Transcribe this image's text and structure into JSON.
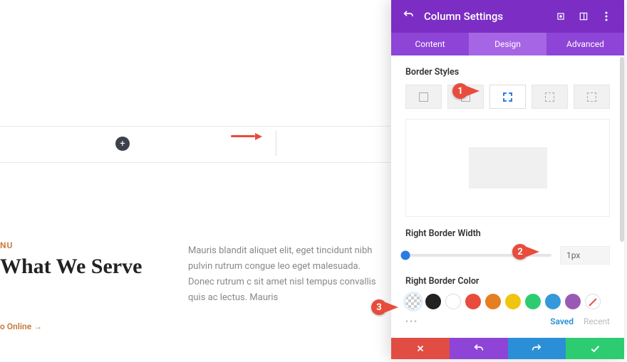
{
  "page": {
    "menu_label": "NU",
    "headline": "What We Serve",
    "paragraph": "Mauris blandit aliquet elit, eget tincidunt nibh pulvin rutrum congue leo eget malesuada. Donec rutrum c sit amet nisl tempus convallis quis ac lectus. Mauris",
    "link_label": "o Online",
    "link_arrow": "→",
    "add_button": "+"
  },
  "panel": {
    "title": "Column Settings",
    "tabs": {
      "content": "Content",
      "design": "Design",
      "advanced": "Advanced"
    },
    "border_styles_label": "Border Styles",
    "right_width_label": "Right Border Width",
    "right_width_value": "1px",
    "right_color_label": "Right Border Color",
    "footer": {
      "saved": "Saved",
      "recent": "Recent",
      "dots": "•••"
    },
    "swatches": [
      {
        "name": "transparent",
        "color": "checker"
      },
      {
        "name": "black",
        "color": "#222"
      },
      {
        "name": "white",
        "color": "whitebd"
      },
      {
        "name": "red",
        "color": "#e74c3c"
      },
      {
        "name": "orange",
        "color": "#e67e22"
      },
      {
        "name": "yellow",
        "color": "#f1c40f"
      },
      {
        "name": "green",
        "color": "#2ecc71"
      },
      {
        "name": "blue",
        "color": "#3498db"
      },
      {
        "name": "purple",
        "color": "#9b59b6"
      },
      {
        "name": "none",
        "color": "strike"
      }
    ]
  },
  "callouts": {
    "one": "1",
    "two": "2",
    "three": "3"
  }
}
